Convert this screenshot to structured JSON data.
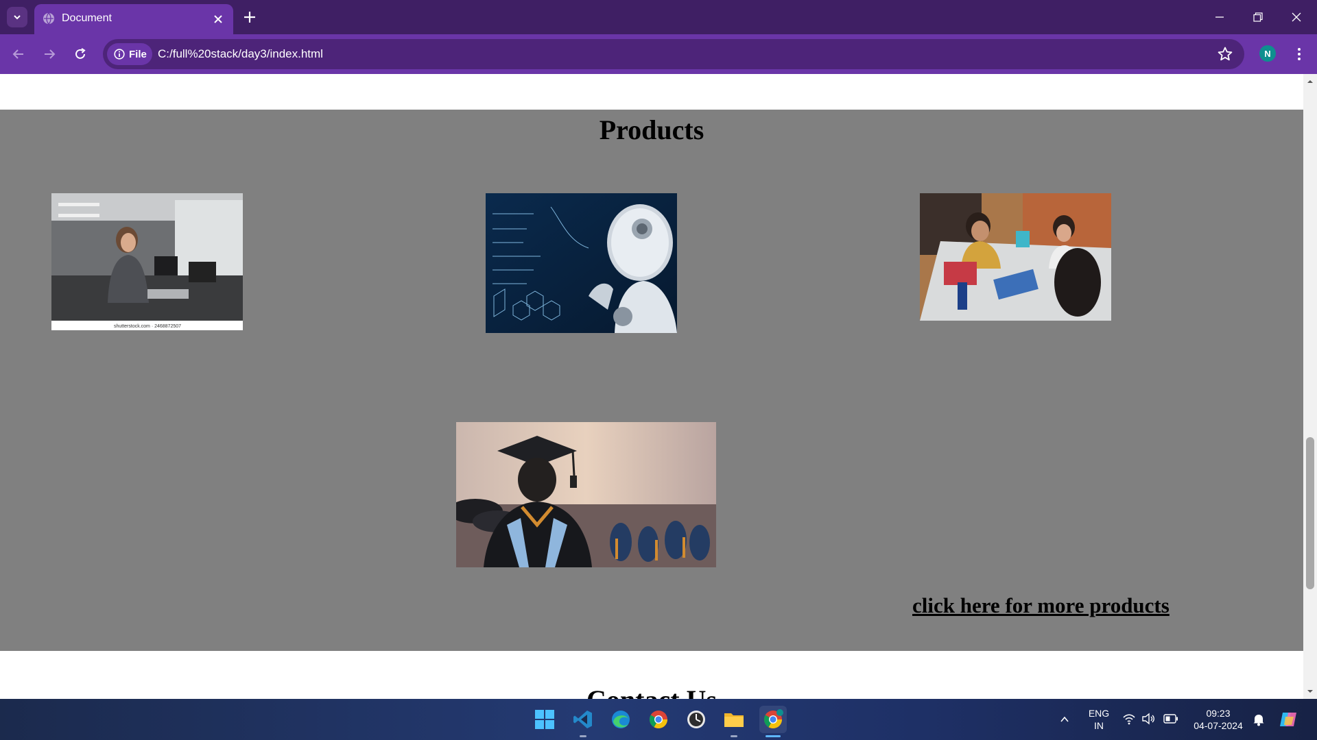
{
  "browser": {
    "tab_title": "Document",
    "site_chip_label": "File",
    "url": "C:/full%20stack/day3/index.html",
    "profile_initial": "N"
  },
  "page": {
    "products_title": "Products",
    "products": [
      {
        "alt": "Woman working on electronics in a lab",
        "caption": "shutterstock.com · 2468872507"
      },
      {
        "alt": "Robot thinking in front of math formulas"
      },
      {
        "alt": "Students collaborating at a table with laptops"
      },
      {
        "alt": "Graduate in cap and gown facing audience"
      }
    ],
    "more_link": "click here for more products",
    "contact_title": "Contact Us"
  },
  "taskbar": {
    "lang_primary": "ENG",
    "lang_secondary": "IN",
    "time": "09:23",
    "date": "04-07-2024"
  },
  "colors": {
    "tabbar": "#3f1f64",
    "toolbar": "#6a35a8",
    "section_bg": "#808080"
  }
}
